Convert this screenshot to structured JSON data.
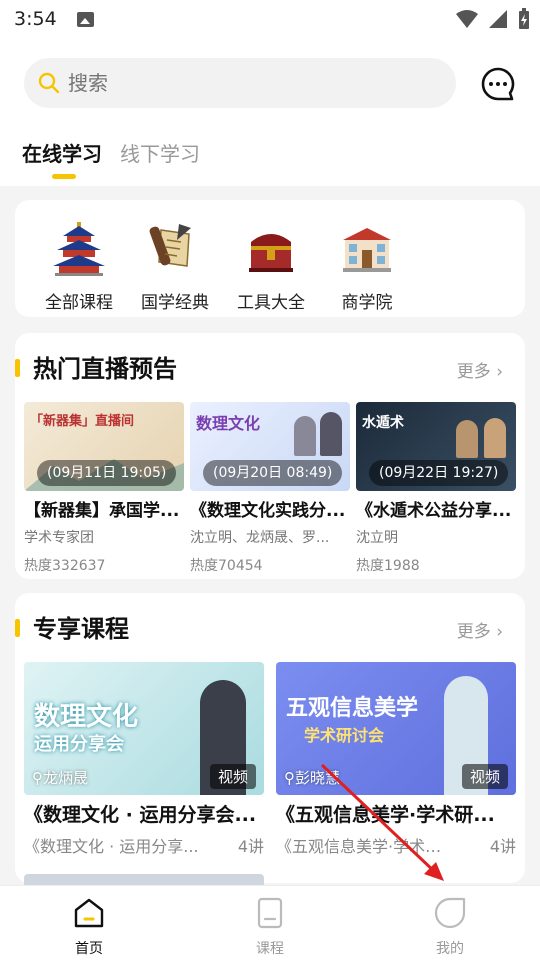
{
  "status_bar": {
    "time": "3:54"
  },
  "search": {
    "placeholder": "搜索"
  },
  "tabs": [
    {
      "label": "在线学习",
      "active": true
    },
    {
      "label": "线下学习",
      "active": false
    }
  ],
  "categories": [
    {
      "label": "全部课程",
      "icon": "temple-icon"
    },
    {
      "label": "国学经典",
      "icon": "scroll-icon"
    },
    {
      "label": "工具大全",
      "icon": "treasure-chest-icon"
    },
    {
      "label": "商学院",
      "icon": "school-building-icon"
    }
  ],
  "live_section": {
    "title": "热门直播预告",
    "more": "更多",
    "items": [
      {
        "time": "(09月11日 19:05)",
        "title": "【新器集】承国学...",
        "host": "学术专家团",
        "heat": "热度332637",
        "banner": "「新器集」直播间"
      },
      {
        "time": "(09月20日 08:49)",
        "title": "《数理文化实践分...",
        "host": "沈立明、龙炳晟、罗...",
        "heat": "热度70454",
        "banner": "数理文化"
      },
      {
        "time": "(09月22日 19:27)",
        "title": "《水遁术公益分享...",
        "host": "沈立明",
        "heat": "热度1988",
        "banner": "水遁术"
      }
    ]
  },
  "exclusive_section": {
    "title": "专享课程",
    "more": "更多",
    "items": [
      {
        "banner_line1": "数理文化",
        "banner_line2": "运用分享会",
        "author": "龙炳晟",
        "badge": "视频",
        "title": "《数理文化 · 运用分享会...",
        "desc": "《数理文化 · 运用分享...",
        "lessons": "4讲"
      },
      {
        "banner_line1": "五观信息美学",
        "banner_line2": "学术研讨会",
        "author": "彭晓慧",
        "badge": "视频",
        "title": "《五观信息美学·学术研...",
        "desc": "《五观信息美学·学术研...",
        "lessons": "4讲"
      }
    ]
  },
  "bottom_nav": [
    {
      "label": "首页",
      "active": true
    },
    {
      "label": "课程",
      "active": false
    },
    {
      "label": "我的",
      "active": false
    }
  ],
  "colors": {
    "accent": "#f7c500",
    "arrow": "#e02020"
  }
}
